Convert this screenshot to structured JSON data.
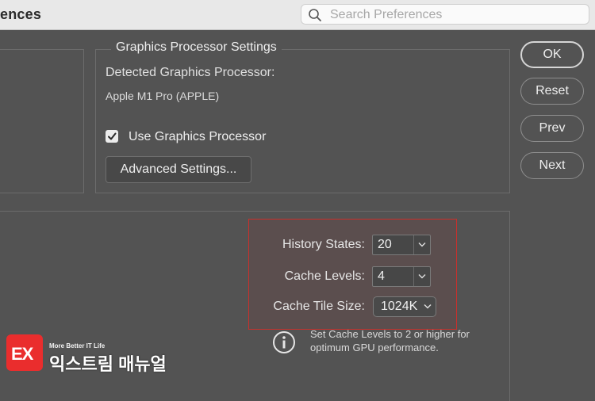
{
  "window": {
    "title": "ences"
  },
  "search": {
    "placeholder": "Search Preferences",
    "value": ""
  },
  "gpu": {
    "legend": "Graphics Processor Settings",
    "detected_label": "Detected Graphics Processor:",
    "processor_name": "Apple M1 Pro (APPLE)",
    "use_gpu_label": "Use Graphics Processor",
    "use_gpu_checked": true,
    "advanced_button": "Advanced Settings..."
  },
  "side_buttons": {
    "ok": "OK",
    "reset": "Reset",
    "prev": "Prev",
    "next": "Next"
  },
  "cache": {
    "history_label": "History States:",
    "history_value": "20",
    "levels_label": "Cache Levels:",
    "levels_value": "4",
    "tile_label": "Cache Tile Size:",
    "tile_value": "1024K",
    "info_text": "Set Cache Levels to 2 or higher for optimum GPU performance."
  },
  "watermark": {
    "logo_text": "EX",
    "tagline": "More Better IT Life",
    "name": "익스트림 매뉴얼"
  },
  "colors": {
    "panel_bg": "#535353",
    "highlight_border": "#c9302c",
    "watermark_red": "#ea2d2d"
  },
  "icons": {
    "search": "magnifier-icon",
    "check": "checkmark-icon",
    "combo_arrow": "chevron-down-icon",
    "info": "info-circle-icon"
  }
}
